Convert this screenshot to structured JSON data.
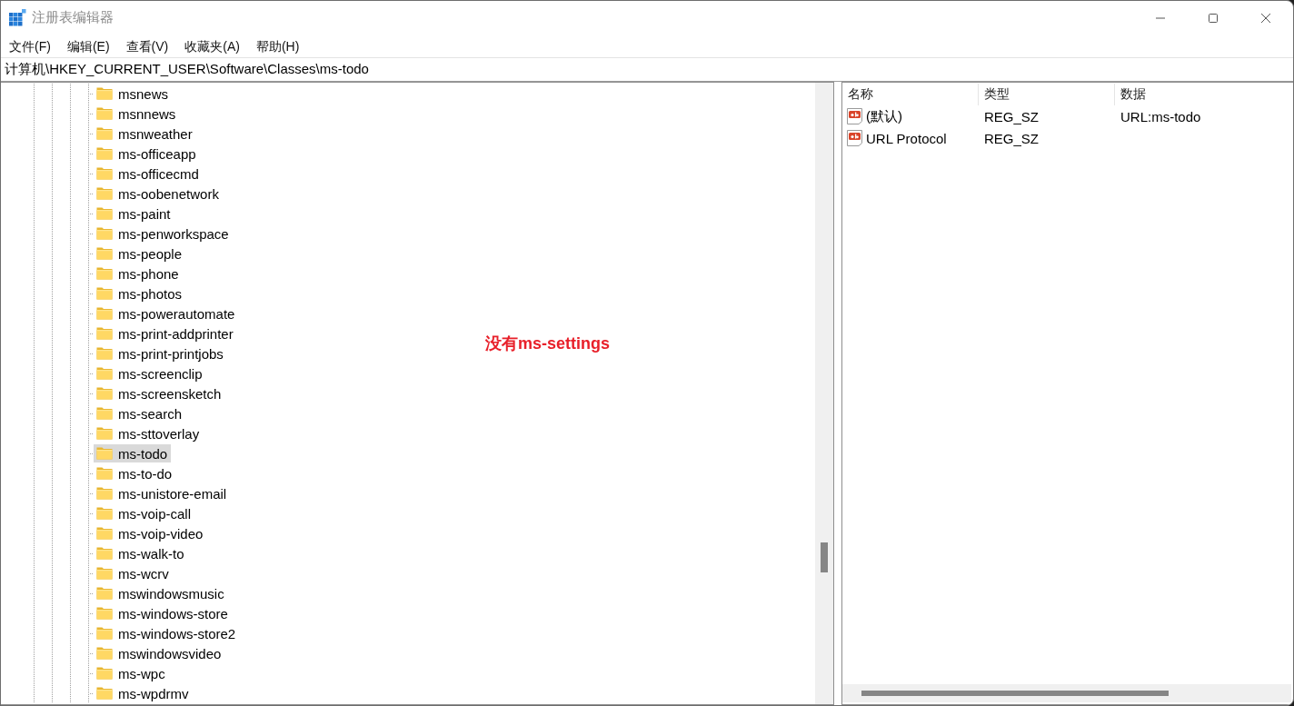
{
  "window": {
    "title": "注册表编辑器"
  },
  "menu": [
    "文件(F)",
    "编辑(E)",
    "查看(V)",
    "收藏夹(A)",
    "帮助(H)"
  ],
  "address_bar": {
    "value": "计算机\\HKEY_CURRENT_USER\\Software\\Classes\\ms-todo"
  },
  "tree": {
    "items": [
      {
        "label": "msnews",
        "selected": false
      },
      {
        "label": "msnnews",
        "selected": false
      },
      {
        "label": "msnweather",
        "selected": false
      },
      {
        "label": "ms-officeapp",
        "selected": false
      },
      {
        "label": "ms-officecmd",
        "selected": false
      },
      {
        "label": "ms-oobenetwork",
        "selected": false
      },
      {
        "label": "ms-paint",
        "selected": false
      },
      {
        "label": "ms-penworkspace",
        "selected": false
      },
      {
        "label": "ms-people",
        "selected": false
      },
      {
        "label": "ms-phone",
        "selected": false
      },
      {
        "label": "ms-photos",
        "selected": false
      },
      {
        "label": "ms-powerautomate",
        "selected": false
      },
      {
        "label": "ms-print-addprinter",
        "selected": false
      },
      {
        "label": "ms-print-printjobs",
        "selected": false
      },
      {
        "label": "ms-screenclip",
        "selected": false
      },
      {
        "label": "ms-screensketch",
        "selected": false
      },
      {
        "label": "ms-search",
        "selected": false
      },
      {
        "label": "ms-sttoverlay",
        "selected": false
      },
      {
        "label": "ms-todo",
        "selected": true
      },
      {
        "label": "ms-to-do",
        "selected": false
      },
      {
        "label": "ms-unistore-email",
        "selected": false
      },
      {
        "label": "ms-voip-call",
        "selected": false
      },
      {
        "label": "ms-voip-video",
        "selected": false
      },
      {
        "label": "ms-walk-to",
        "selected": false
      },
      {
        "label": "ms-wcrv",
        "selected": false
      },
      {
        "label": "mswindowsmusic",
        "selected": false
      },
      {
        "label": "ms-windows-store",
        "selected": false
      },
      {
        "label": "ms-windows-store2",
        "selected": false
      },
      {
        "label": "mswindowsvideo",
        "selected": false
      },
      {
        "label": "ms-wpc",
        "selected": false
      },
      {
        "label": "ms-wpdrmv",
        "selected": false
      }
    ]
  },
  "annotation": {
    "text": "没有ms-settings"
  },
  "values_table": {
    "columns": [
      "名称",
      "类型",
      "数据"
    ],
    "rows": [
      {
        "name": "(默认)",
        "type": "REG_SZ",
        "data": "URL:ms-todo"
      },
      {
        "name": "URL Protocol",
        "type": "REG_SZ"
      }
    ]
  }
}
